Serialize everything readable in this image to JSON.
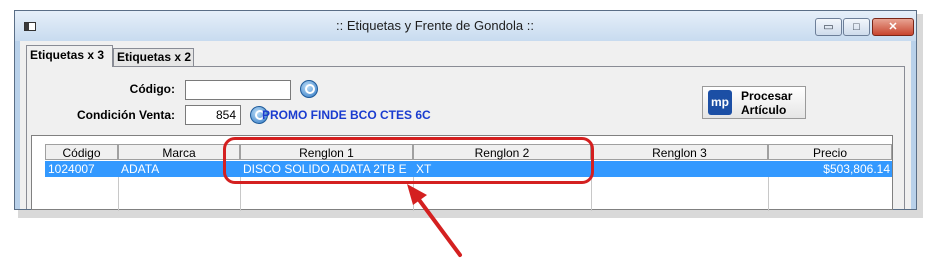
{
  "window": {
    "title": ":: Etiquetas y Frente de Gondola ::"
  },
  "window_controls": {
    "minimize": "▭",
    "maximize": "□",
    "close": "✕"
  },
  "tabs": [
    {
      "label": "Etiquetas x 3"
    },
    {
      "label": "Etiquetas x 2"
    }
  ],
  "form": {
    "codigo_label": "Código:",
    "codigo_value": "",
    "condicion_label": "Condición Venta:",
    "condicion_value": "854",
    "condicion_desc": "PROMO FINDE BCO CTES 6C"
  },
  "process_button": {
    "line1": "Procesar",
    "line2": "Artículo",
    "icon": "mp-logo-icon"
  },
  "grid": {
    "columns": [
      "Código",
      "Marca",
      "Renglon 1",
      "Renglon 2",
      "Renglon 3",
      "Precio"
    ],
    "rows": [
      {
        "codigo": "1024007",
        "marca": "ADATA",
        "renglon1": "DISCO SOLIDO ADATA 2TB E",
        "renglon2": "XT",
        "renglon3": "",
        "precio": "$503,806.14"
      }
    ]
  },
  "colors": {
    "selection": "#3399ff",
    "annotation": "#d42020",
    "promo_text": "#1a3ccf"
  }
}
